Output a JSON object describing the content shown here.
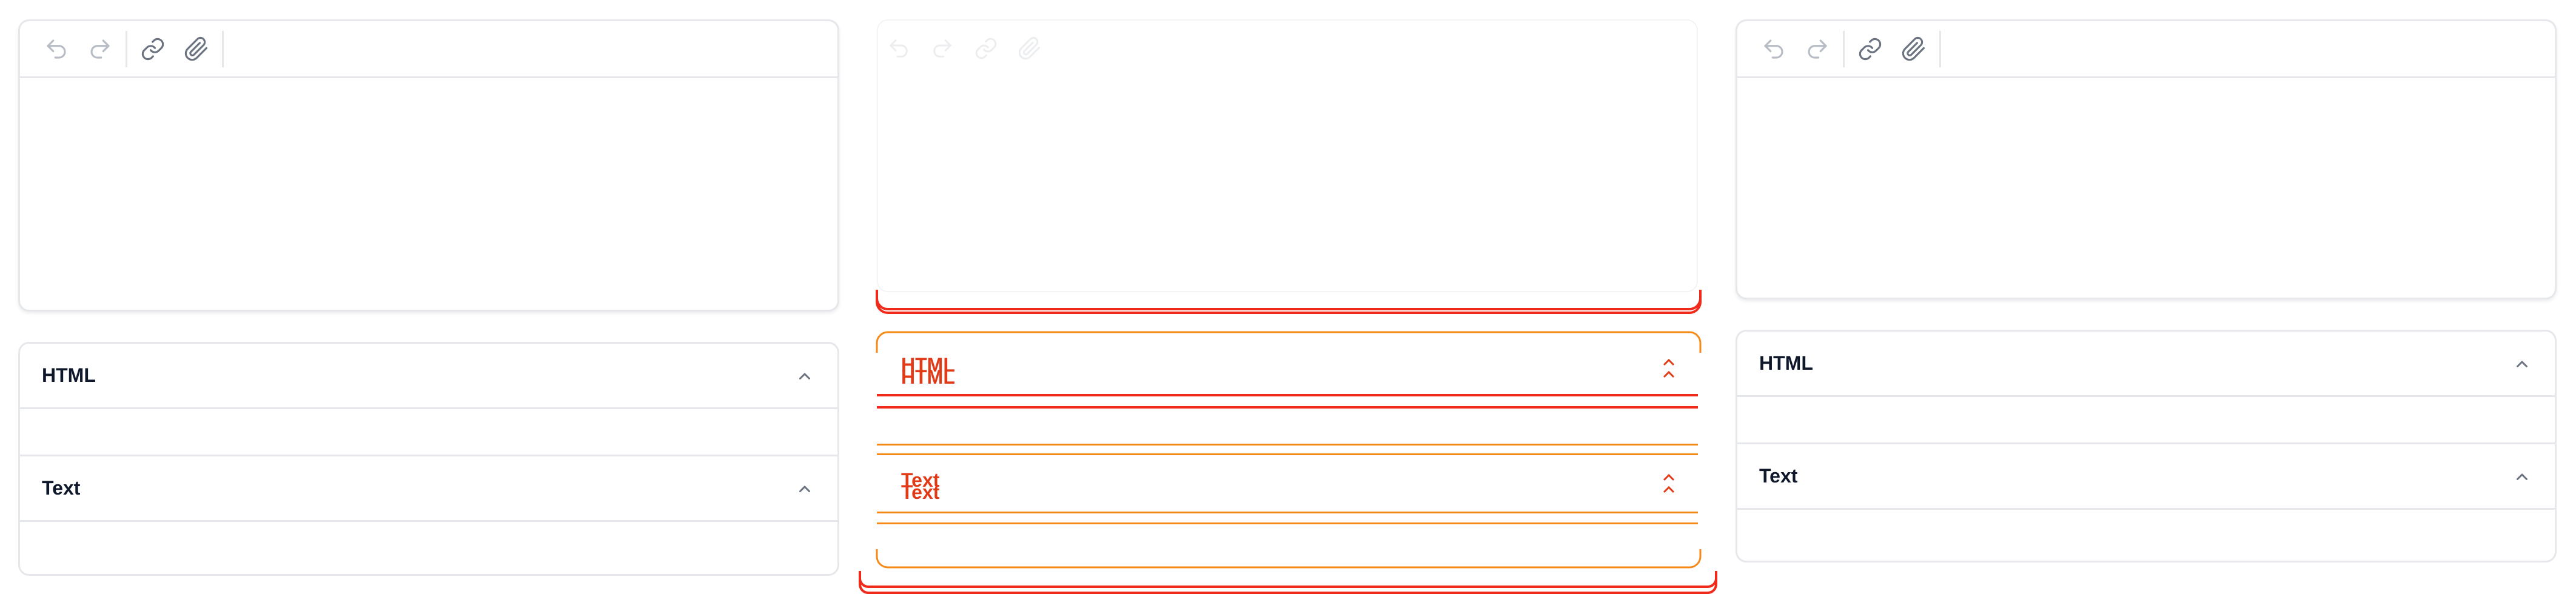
{
  "colors": {
    "border": "#e5e7eb",
    "icon": "#9ca3af",
    "title": "#0f172a",
    "transition_red": "#ef2a1a",
    "transition_orange": "#f58a16"
  },
  "toolbar": {
    "buttons": [
      {
        "icon": "undo-icon"
      },
      {
        "icon": "redo-icon"
      },
      {
        "icon": "link-icon"
      },
      {
        "icon": "paperclip-icon"
      }
    ]
  },
  "panels": {
    "left": {
      "sections": [
        {
          "title": "HTML"
        },
        {
          "title": "Text"
        }
      ]
    },
    "middle": {
      "sections": [
        {
          "title": "HTML"
        },
        {
          "title": "Text"
        }
      ]
    },
    "right": {
      "sections": [
        {
          "title": "HTML"
        },
        {
          "title": "Text"
        }
      ]
    }
  }
}
